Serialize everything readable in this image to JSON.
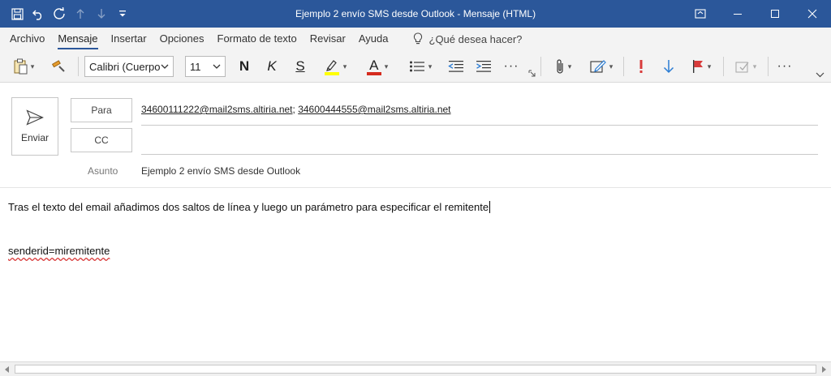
{
  "window": {
    "title": "Ejemplo 2 envío SMS desde Outlook  -  Mensaje (HTML)"
  },
  "quick_access": {
    "icons": [
      "save-icon",
      "undo-icon",
      "redo-icon",
      "up-arrow-icon",
      "down-arrow-icon",
      "customize-icon"
    ]
  },
  "menu": {
    "tabs": [
      "Archivo",
      "Mensaje",
      "Insertar",
      "Opciones",
      "Formato de texto",
      "Revisar",
      "Ayuda"
    ],
    "active_tab": "Mensaje",
    "tell_me": "¿Qué desea hacer?"
  },
  "ribbon": {
    "font_name": "Calibri (Cuerpo",
    "font_size": "11",
    "bold": "N",
    "italic": "K",
    "strike": "S",
    "font_color_letter": "A",
    "highlight_color": "#ffff00",
    "font_color": "#d52b1e",
    "more": "···"
  },
  "compose": {
    "send_label": "Enviar",
    "to_label": "Para",
    "cc_label": "CC",
    "subject_label": "Asunto",
    "to_addresses": [
      "34600111222@mail2sms.altiria.net",
      "34600444555@mail2sms.altiria.net"
    ],
    "to_separator": ";",
    "subject": "Ejemplo 2 envío SMS desde Outlook"
  },
  "body": {
    "line1": "Tras el texto del email añadimos dos saltos de línea y luego un parámetro para especificar el remitente",
    "line2": "senderid=miremitente"
  },
  "colors": {
    "titlebar": "#2b579a",
    "ribbon_bg": "#f3f3f3",
    "accent": "#2b579a",
    "importance_high": "#d83b3b",
    "importance_low": "#2b7cd3"
  }
}
